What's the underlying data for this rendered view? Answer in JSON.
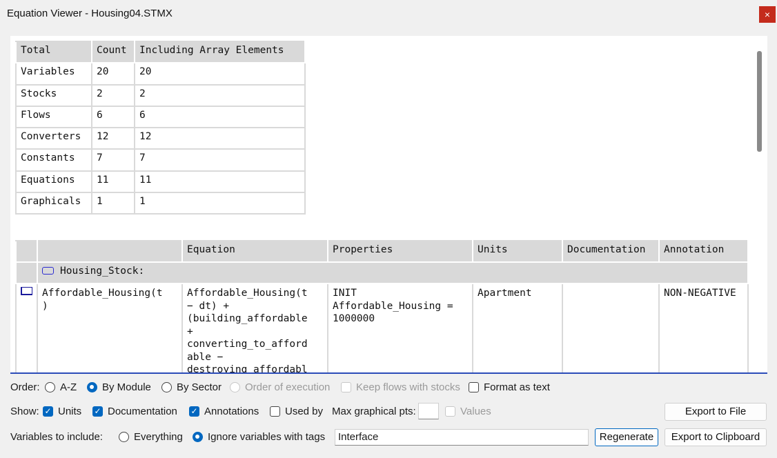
{
  "window": {
    "title": "Equation Viewer - Housing04.STMX",
    "close_label": "×"
  },
  "summary": {
    "headers": [
      "Total",
      "Count",
      "Including Array Elements"
    ],
    "rows": [
      [
        "Variables",
        "20",
        "20"
      ],
      [
        "Stocks",
        "2",
        "2"
      ],
      [
        "Flows",
        "6",
        "6"
      ],
      [
        "Converters",
        "12",
        "12"
      ],
      [
        "Constants",
        "7",
        "7"
      ],
      [
        "Equations",
        "11",
        "11"
      ],
      [
        "Graphicals",
        "1",
        "1"
      ]
    ]
  },
  "equations": {
    "headers": [
      "",
      "",
      "Equation",
      "Properties",
      "Units",
      "Documentation",
      "Annotation"
    ],
    "module_name": "Housing_Stock:",
    "rows": [
      {
        "name": "Affordable_Housing(t\n)",
        "equation": "Affordable_Housing(t\n− dt) +\n(building_affordable\n+\nconverting_to_afford\nable −\ndestroying_affordabl",
        "properties": "INIT\nAffordable_Housing =\n1000000",
        "units": "Apartment",
        "documentation": "",
        "annotation": "NON-NEGATIVE"
      }
    ]
  },
  "controls": {
    "order_label": "Order:",
    "order_options": [
      "A-Z",
      "By Module",
      "By Sector",
      "Order of execution"
    ],
    "order_selected": "By Module",
    "keep_flows_label": "Keep flows with stocks",
    "format_text_label": "Format as text",
    "show_label": "Show:",
    "show_units": "Units",
    "show_documentation": "Documentation",
    "show_annotations": "Annotations",
    "show_used_by": "Used by",
    "max_graphical_label": "Max graphical pts:",
    "max_graphical_value": "",
    "values_label": "Values",
    "vars_include_label": "Variables to include:",
    "include_everything": "Everything",
    "include_ignore_tags": "Ignore variables with tags",
    "tags_value": "Interface",
    "regenerate_label": "Regenerate",
    "export_file_label": "Export to File",
    "export_clipboard_label": "Export to Clipboard"
  }
}
